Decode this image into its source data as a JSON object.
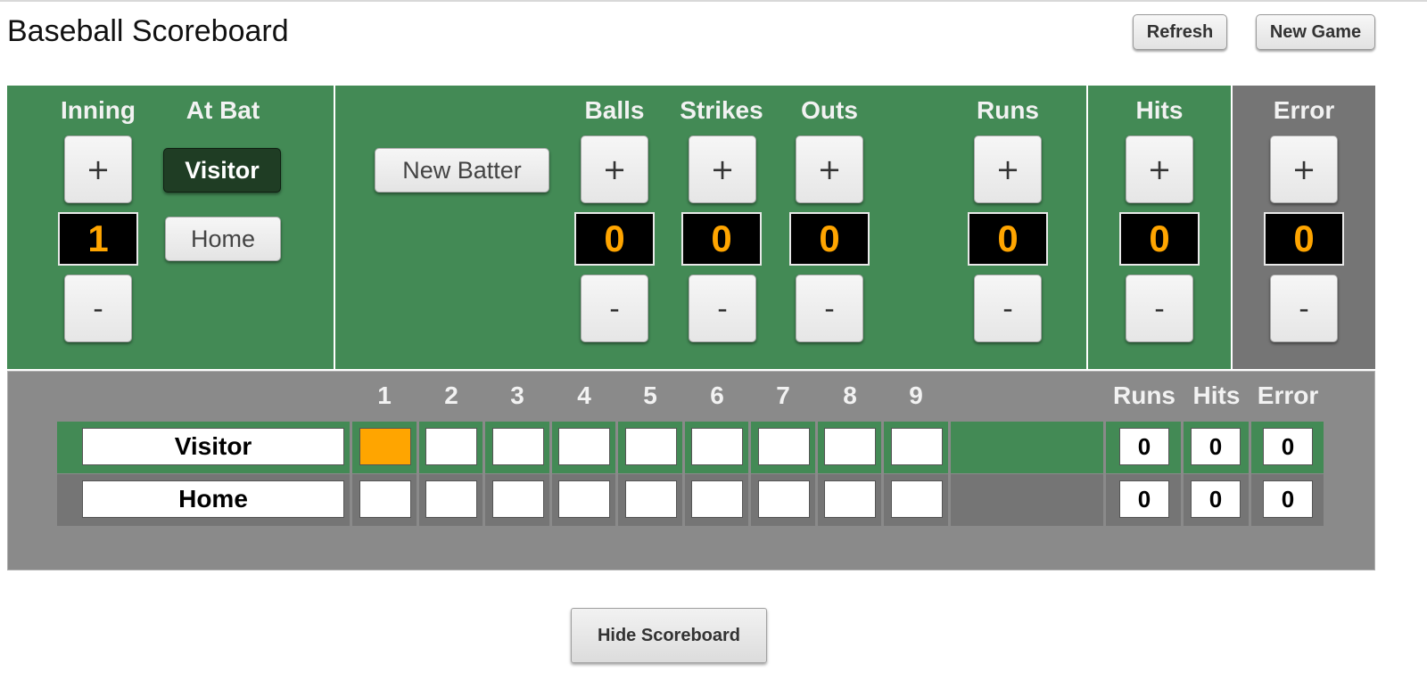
{
  "app": {
    "title": "Baseball Scoreboard"
  },
  "toolbar": {
    "refresh_label": "Refresh",
    "new_game_label": "New Game"
  },
  "controls": {
    "inning": {
      "label": "Inning",
      "value": "1",
      "plus": "+",
      "minus": "-"
    },
    "at_bat": {
      "label": "At Bat",
      "visitor_label": "Visitor",
      "home_label": "Home",
      "selected": "Visitor"
    },
    "new_batter_label": "New Batter",
    "balls": {
      "label": "Balls",
      "value": "0",
      "plus": "+",
      "minus": "-"
    },
    "strikes": {
      "label": "Strikes",
      "value": "0",
      "plus": "+",
      "minus": "-"
    },
    "outs": {
      "label": "Outs",
      "value": "0",
      "plus": "+",
      "minus": "-"
    },
    "runs": {
      "label": "Runs",
      "value": "0",
      "plus": "+",
      "minus": "-"
    },
    "hits": {
      "label": "Hits",
      "value": "0",
      "plus": "+",
      "minus": "-"
    },
    "error": {
      "label": "Error",
      "value": "0",
      "plus": "+",
      "minus": "-"
    }
  },
  "scoreboard": {
    "innings": [
      "1",
      "2",
      "3",
      "4",
      "5",
      "6",
      "7",
      "8",
      "9"
    ],
    "totals_headers": {
      "runs": "Runs",
      "hits": "Hits",
      "error": "Error"
    },
    "active_inning": 1,
    "rows": [
      {
        "team": "Visitor",
        "innings": [
          "",
          "",
          "",
          "",
          "",
          "",
          "",
          "",
          ""
        ],
        "runs": "0",
        "hits": "0",
        "error": "0"
      },
      {
        "team": "Home",
        "innings": [
          "",
          "",
          "",
          "",
          "",
          "",
          "",
          "",
          ""
        ],
        "runs": "0",
        "hits": "0",
        "error": "0"
      }
    ]
  },
  "footer": {
    "hide_label": "Hide Scoreboard"
  },
  "colors": {
    "accent": "#ffa500",
    "panel_green": "#438a55",
    "panel_gray": "#757575",
    "board_gray": "#8a8a8a"
  },
  "icons": {
    "plus": "plus-icon",
    "minus": "minus-icon"
  }
}
